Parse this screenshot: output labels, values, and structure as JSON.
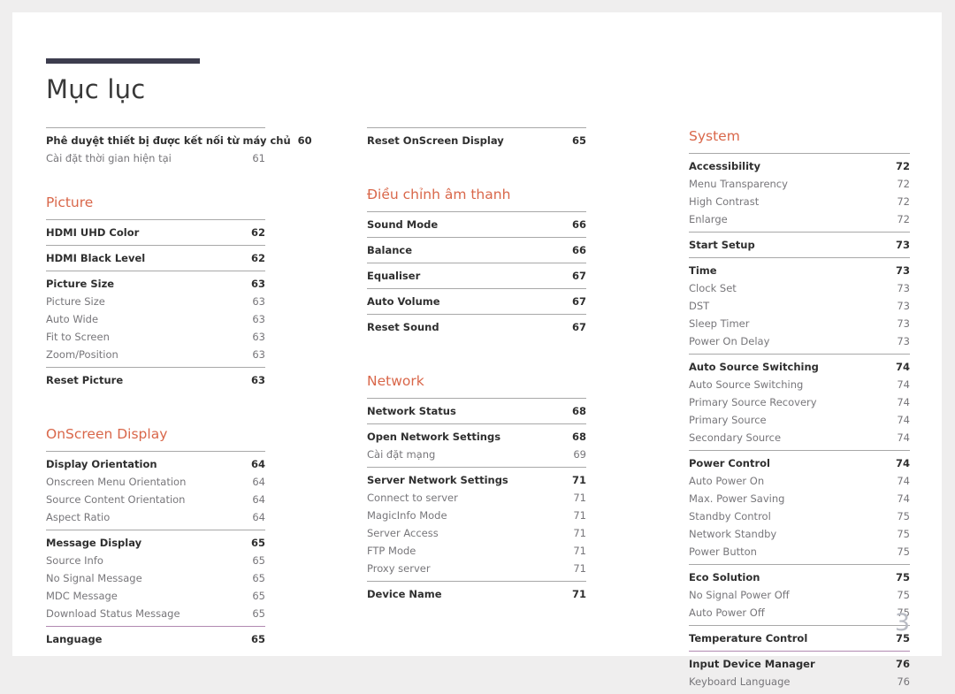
{
  "document": {
    "title": "Mục lục",
    "folio": "3"
  },
  "colors": {
    "accent": "#d9674a",
    "title_rule": "#3d3d4e",
    "group_rule": "#a8a8a8",
    "purple_rule": "#b189b1",
    "main_text": "#2f2f2f",
    "sub_text": "#77767a",
    "folio": "#b9bcc4"
  },
  "columns": [
    {
      "name": "column-1",
      "blocks": [
        {
          "type": "group",
          "rule": "gray",
          "rows": [
            {
              "label": "Phê duyệt thiết bị được kết nối từ máy chủ",
              "page": "60",
              "level": "main"
            },
            {
              "label": "Cài đặt thời gian hiện tại",
              "page": "61",
              "level": "sub"
            }
          ]
        },
        {
          "type": "spacer",
          "size": "lg"
        },
        {
          "type": "heading",
          "label": "Picture"
        },
        {
          "type": "group",
          "rule": "gray",
          "rows": [
            {
              "label": "HDMI UHD Color",
              "page": "62",
              "level": "main"
            }
          ]
        },
        {
          "type": "group",
          "rule": "gray",
          "rows": [
            {
              "label": "HDMI Black Level",
              "page": "62",
              "level": "main"
            }
          ]
        },
        {
          "type": "group",
          "rule": "gray",
          "rows": [
            {
              "label": "Picture Size",
              "page": "63",
              "level": "main"
            },
            {
              "label": "Picture Size",
              "page": "63",
              "level": "sub"
            },
            {
              "label": "Auto Wide",
              "page": "63",
              "level": "sub"
            },
            {
              "label": "Fit to Screen",
              "page": "63",
              "level": "sub"
            },
            {
              "label": "Zoom/Position",
              "page": "63",
              "level": "sub"
            }
          ]
        },
        {
          "type": "group",
          "rule": "gray",
          "rows": [
            {
              "label": "Reset Picture",
              "page": "63",
              "level": "main"
            }
          ]
        },
        {
          "type": "heading-spaced",
          "label": "OnScreen Display"
        },
        {
          "type": "group",
          "rule": "gray",
          "rows": [
            {
              "label": "Display Orientation",
              "page": "64",
              "level": "main"
            },
            {
              "label": "Onscreen Menu Orientation",
              "page": "64",
              "level": "sub"
            },
            {
              "label": "Source Content Orientation",
              "page": "64",
              "level": "sub"
            },
            {
              "label": "Aspect Ratio",
              "page": "64",
              "level": "sub"
            }
          ]
        },
        {
          "type": "group",
          "rule": "gray",
          "rows": [
            {
              "label": "Message Display",
              "page": "65",
              "level": "main"
            },
            {
              "label": "Source Info",
              "page": "65",
              "level": "sub"
            },
            {
              "label": "No Signal Message",
              "page": "65",
              "level": "sub"
            },
            {
              "label": "MDC Message",
              "page": "65",
              "level": "sub"
            },
            {
              "label": "Download Status Message",
              "page": "65",
              "level": "sub"
            }
          ]
        },
        {
          "type": "group",
          "rule": "purple",
          "rows": [
            {
              "label": "Language",
              "page": "65",
              "level": "main"
            }
          ]
        }
      ]
    },
    {
      "name": "column-2",
      "blocks": [
        {
          "type": "group",
          "rule": "gray",
          "rows": [
            {
              "label": "Reset OnScreen Display",
              "page": "65",
              "level": "main"
            }
          ]
        },
        {
          "type": "heading-spaced",
          "label": "Điều chỉnh âm thanh"
        },
        {
          "type": "group",
          "rule": "gray",
          "rows": [
            {
              "label": "Sound Mode",
              "page": "66",
              "level": "main"
            }
          ]
        },
        {
          "type": "group",
          "rule": "gray",
          "rows": [
            {
              "label": "Balance",
              "page": "66",
              "level": "main"
            }
          ]
        },
        {
          "type": "group",
          "rule": "gray",
          "rows": [
            {
              "label": "Equaliser",
              "page": "67",
              "level": "main"
            }
          ]
        },
        {
          "type": "group",
          "rule": "gray",
          "rows": [
            {
              "label": "Auto Volume",
              "page": "67",
              "level": "main"
            }
          ]
        },
        {
          "type": "group",
          "rule": "gray",
          "rows": [
            {
              "label": "Reset Sound",
              "page": "67",
              "level": "main"
            }
          ]
        },
        {
          "type": "heading-spaced",
          "label": "Network"
        },
        {
          "type": "group",
          "rule": "gray",
          "rows": [
            {
              "label": "Network Status",
              "page": "68",
              "level": "main"
            }
          ]
        },
        {
          "type": "group",
          "rule": "gray",
          "rows": [
            {
              "label": "Open Network Settings",
              "page": "68",
              "level": "main"
            },
            {
              "label": "Cài đặt mạng",
              "page": "69",
              "level": "sub"
            }
          ]
        },
        {
          "type": "group",
          "rule": "gray",
          "rows": [
            {
              "label": "Server Network Settings",
              "page": "71",
              "level": "main"
            },
            {
              "label": "Connect to server",
              "page": "71",
              "level": "sub"
            },
            {
              "label": "MagicInfo Mode",
              "page": "71",
              "level": "sub"
            },
            {
              "label": "Server Access",
              "page": "71",
              "level": "sub"
            },
            {
              "label": "FTP Mode",
              "page": "71",
              "level": "sub"
            },
            {
              "label": "Proxy server",
              "page": "71",
              "level": "sub"
            }
          ]
        },
        {
          "type": "group",
          "rule": "gray",
          "rows": [
            {
              "label": "Device Name",
              "page": "71",
              "level": "main"
            }
          ]
        }
      ]
    },
    {
      "name": "column-3",
      "blocks": [
        {
          "type": "heading",
          "label": "System"
        },
        {
          "type": "group",
          "rule": "gray",
          "rows": [
            {
              "label": "Accessibility",
              "page": "72",
              "level": "main"
            },
            {
              "label": "Menu Transparency",
              "page": "72",
              "level": "sub"
            },
            {
              "label": "High Contrast",
              "page": "72",
              "level": "sub"
            },
            {
              "label": "Enlarge",
              "page": "72",
              "level": "sub"
            }
          ]
        },
        {
          "type": "group",
          "rule": "gray",
          "rows": [
            {
              "label": "Start Setup",
              "page": "73",
              "level": "main"
            }
          ]
        },
        {
          "type": "group",
          "rule": "gray",
          "rows": [
            {
              "label": "Time",
              "page": "73",
              "level": "main"
            },
            {
              "label": "Clock Set",
              "page": "73",
              "level": "sub"
            },
            {
              "label": "DST",
              "page": "73",
              "level": "sub"
            },
            {
              "label": "Sleep Timer",
              "page": "73",
              "level": "sub"
            },
            {
              "label": "Power On Delay",
              "page": "73",
              "level": "sub"
            }
          ]
        },
        {
          "type": "group",
          "rule": "gray",
          "rows": [
            {
              "label": "Auto Source Switching",
              "page": "74",
              "level": "main"
            },
            {
              "label": "Auto Source Switching",
              "page": "74",
              "level": "sub"
            },
            {
              "label": "Primary Source Recovery",
              "page": "74",
              "level": "sub"
            },
            {
              "label": "Primary Source",
              "page": "74",
              "level": "sub"
            },
            {
              "label": "Secondary Source",
              "page": "74",
              "level": "sub"
            }
          ]
        },
        {
          "type": "group",
          "rule": "gray",
          "rows": [
            {
              "label": "Power Control",
              "page": "74",
              "level": "main"
            },
            {
              "label": "Auto Power On",
              "page": "74",
              "level": "sub"
            },
            {
              "label": "Max. Power Saving",
              "page": "74",
              "level": "sub"
            },
            {
              "label": "Standby Control",
              "page": "75",
              "level": "sub"
            },
            {
              "label": "Network Standby",
              "page": "75",
              "level": "sub"
            },
            {
              "label": "Power Button",
              "page": "75",
              "level": "sub"
            }
          ]
        },
        {
          "type": "group",
          "rule": "gray",
          "rows": [
            {
              "label": "Eco Solution",
              "page": "75",
              "level": "main"
            },
            {
              "label": "No Signal Power Off",
              "page": "75",
              "level": "sub"
            },
            {
              "label": "Auto Power Off",
              "page": "75",
              "level": "sub"
            }
          ]
        },
        {
          "type": "group",
          "rule": "gray",
          "rows": [
            {
              "label": "Temperature Control",
              "page": "75",
              "level": "main"
            }
          ]
        },
        {
          "type": "group",
          "rule": "purple",
          "rows": [
            {
              "label": "Input Device Manager",
              "page": "76",
              "level": "main"
            },
            {
              "label": "Keyboard Language",
              "page": "76",
              "level": "sub"
            }
          ]
        }
      ]
    }
  ]
}
